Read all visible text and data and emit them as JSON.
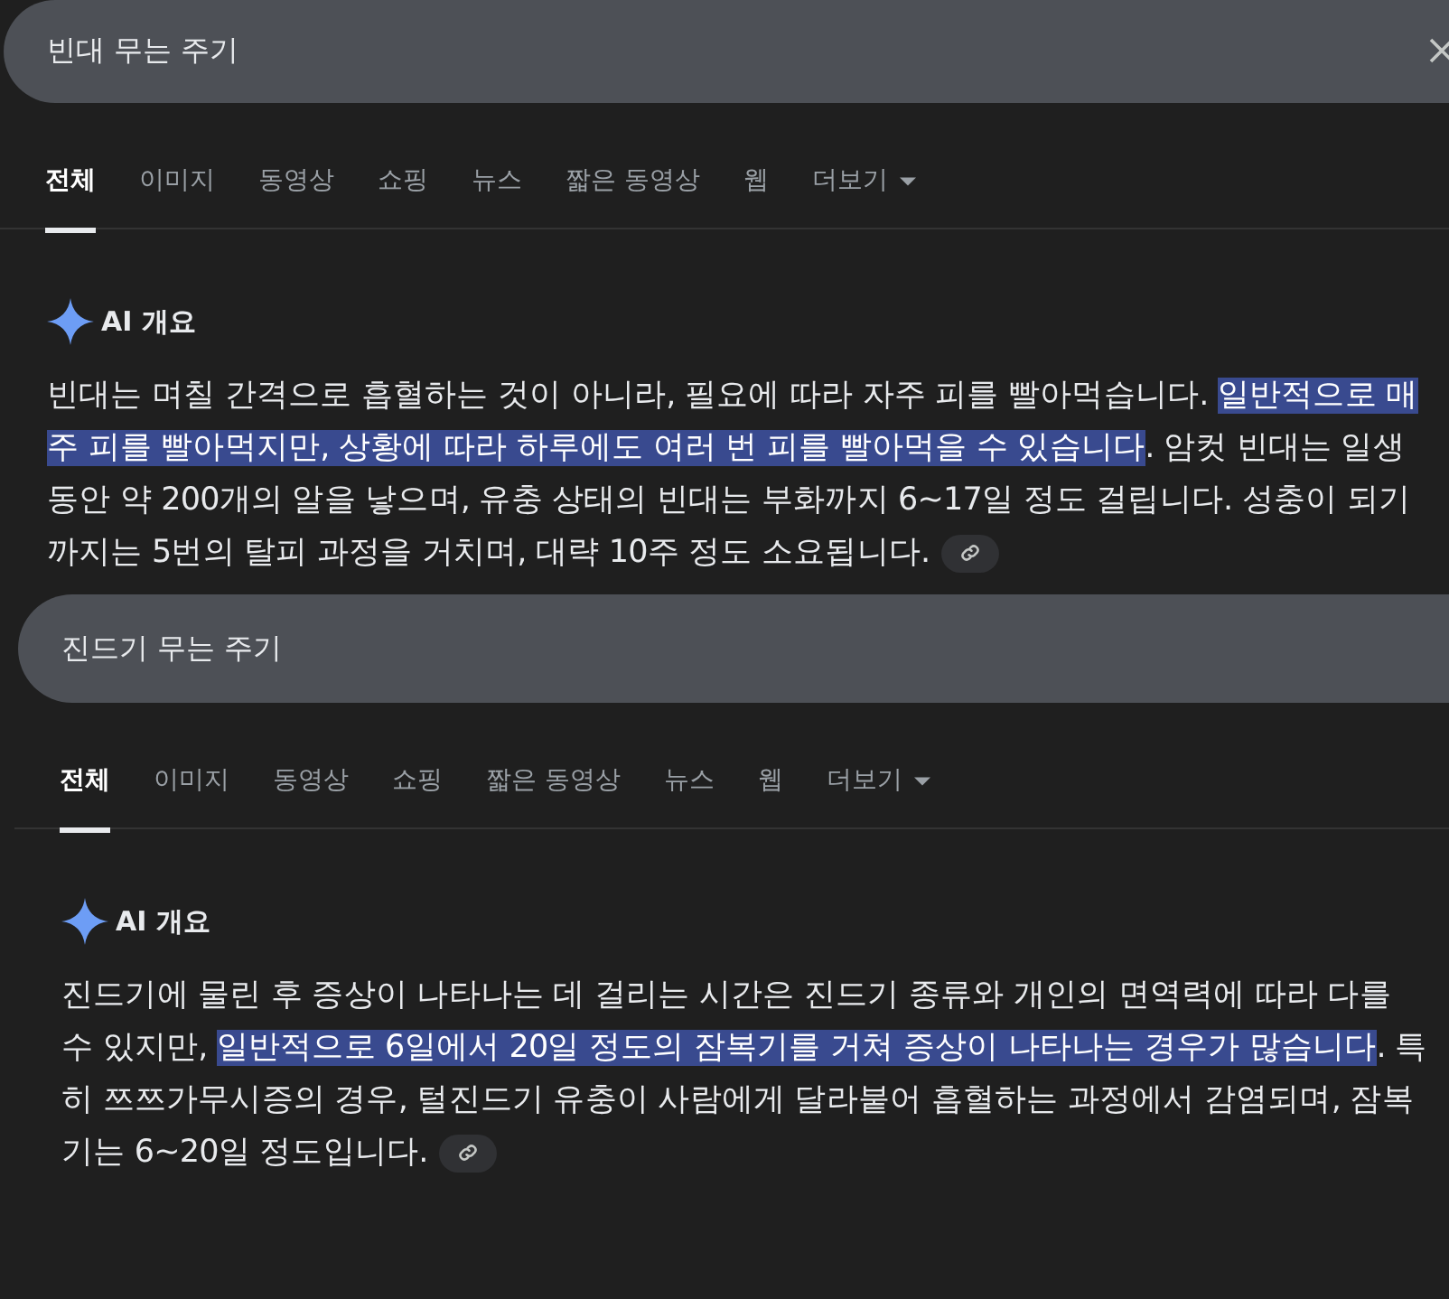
{
  "panels": [
    {
      "search": {
        "value": "빈대 무는 주기",
        "clear_button": true
      },
      "tabs": [
        {
          "label": "전체",
          "selected": true
        },
        {
          "label": "이미지",
          "selected": false
        },
        {
          "label": "동영상",
          "selected": false
        },
        {
          "label": "쇼핑",
          "selected": false
        },
        {
          "label": "뉴스",
          "selected": false
        },
        {
          "label": "짧은 동영상",
          "selected": false
        },
        {
          "label": "웹",
          "selected": false
        },
        {
          "label": "더보기",
          "selected": false,
          "dropdown": true
        }
      ],
      "overview": {
        "title": "AI 개요",
        "segments": [
          {
            "text": "빈대는 며칠 간격으로 흡혈하는 것이 아니라, 필요에 따라 자주 피를 빨아먹습니다. ",
            "highlighted": false
          },
          {
            "text": "일반적으로 매주 피를 빨아먹지만, 상황에 따라 하루에도 여러 번 피를 빨아먹을 수 있습니다",
            "highlighted": true
          },
          {
            "text": ". 암컷 빈대는 일생 동안 약 200개의 알을 낳으며, 유충 상태의 빈대는 부화까지 6~17일 정도 걸립니다. 성충이 되기까지는 5번의 탈피 과정을 거치며, 대략 10주 정도 소요됩니다.",
            "highlighted": false
          }
        ]
      }
    },
    {
      "search": {
        "value": "진드기 무는 주기",
        "clear_button": false
      },
      "tabs": [
        {
          "label": "전체",
          "selected": true
        },
        {
          "label": "이미지",
          "selected": false
        },
        {
          "label": "동영상",
          "selected": false
        },
        {
          "label": "쇼핑",
          "selected": false
        },
        {
          "label": "짧은 동영상",
          "selected": false
        },
        {
          "label": "뉴스",
          "selected": false
        },
        {
          "label": "웹",
          "selected": false
        },
        {
          "label": "더보기",
          "selected": false,
          "dropdown": true
        }
      ],
      "overview": {
        "title": "AI 개요",
        "segments": [
          {
            "text": "진드기에 물린 후 증상이 나타나는 데 걸리는 시간은 진드기 종류와 개인의 면역력에 따라 다를 수 있지만, ",
            "highlighted": false
          },
          {
            "text": "일반적으로 6일에서 20일 정도의 잠복기를 거쳐 증상이 나타나는 경우가 많습니다",
            "highlighted": true
          },
          {
            "text": ". 특히 쯔쯔가무시증의 경우, 털진드기 유충이 사람에게 달라붙어 흡혈하는 과정에서 감염되며, 잠복기는 6~20일 정도입니다.",
            "highlighted": false
          }
        ]
      }
    }
  ]
}
